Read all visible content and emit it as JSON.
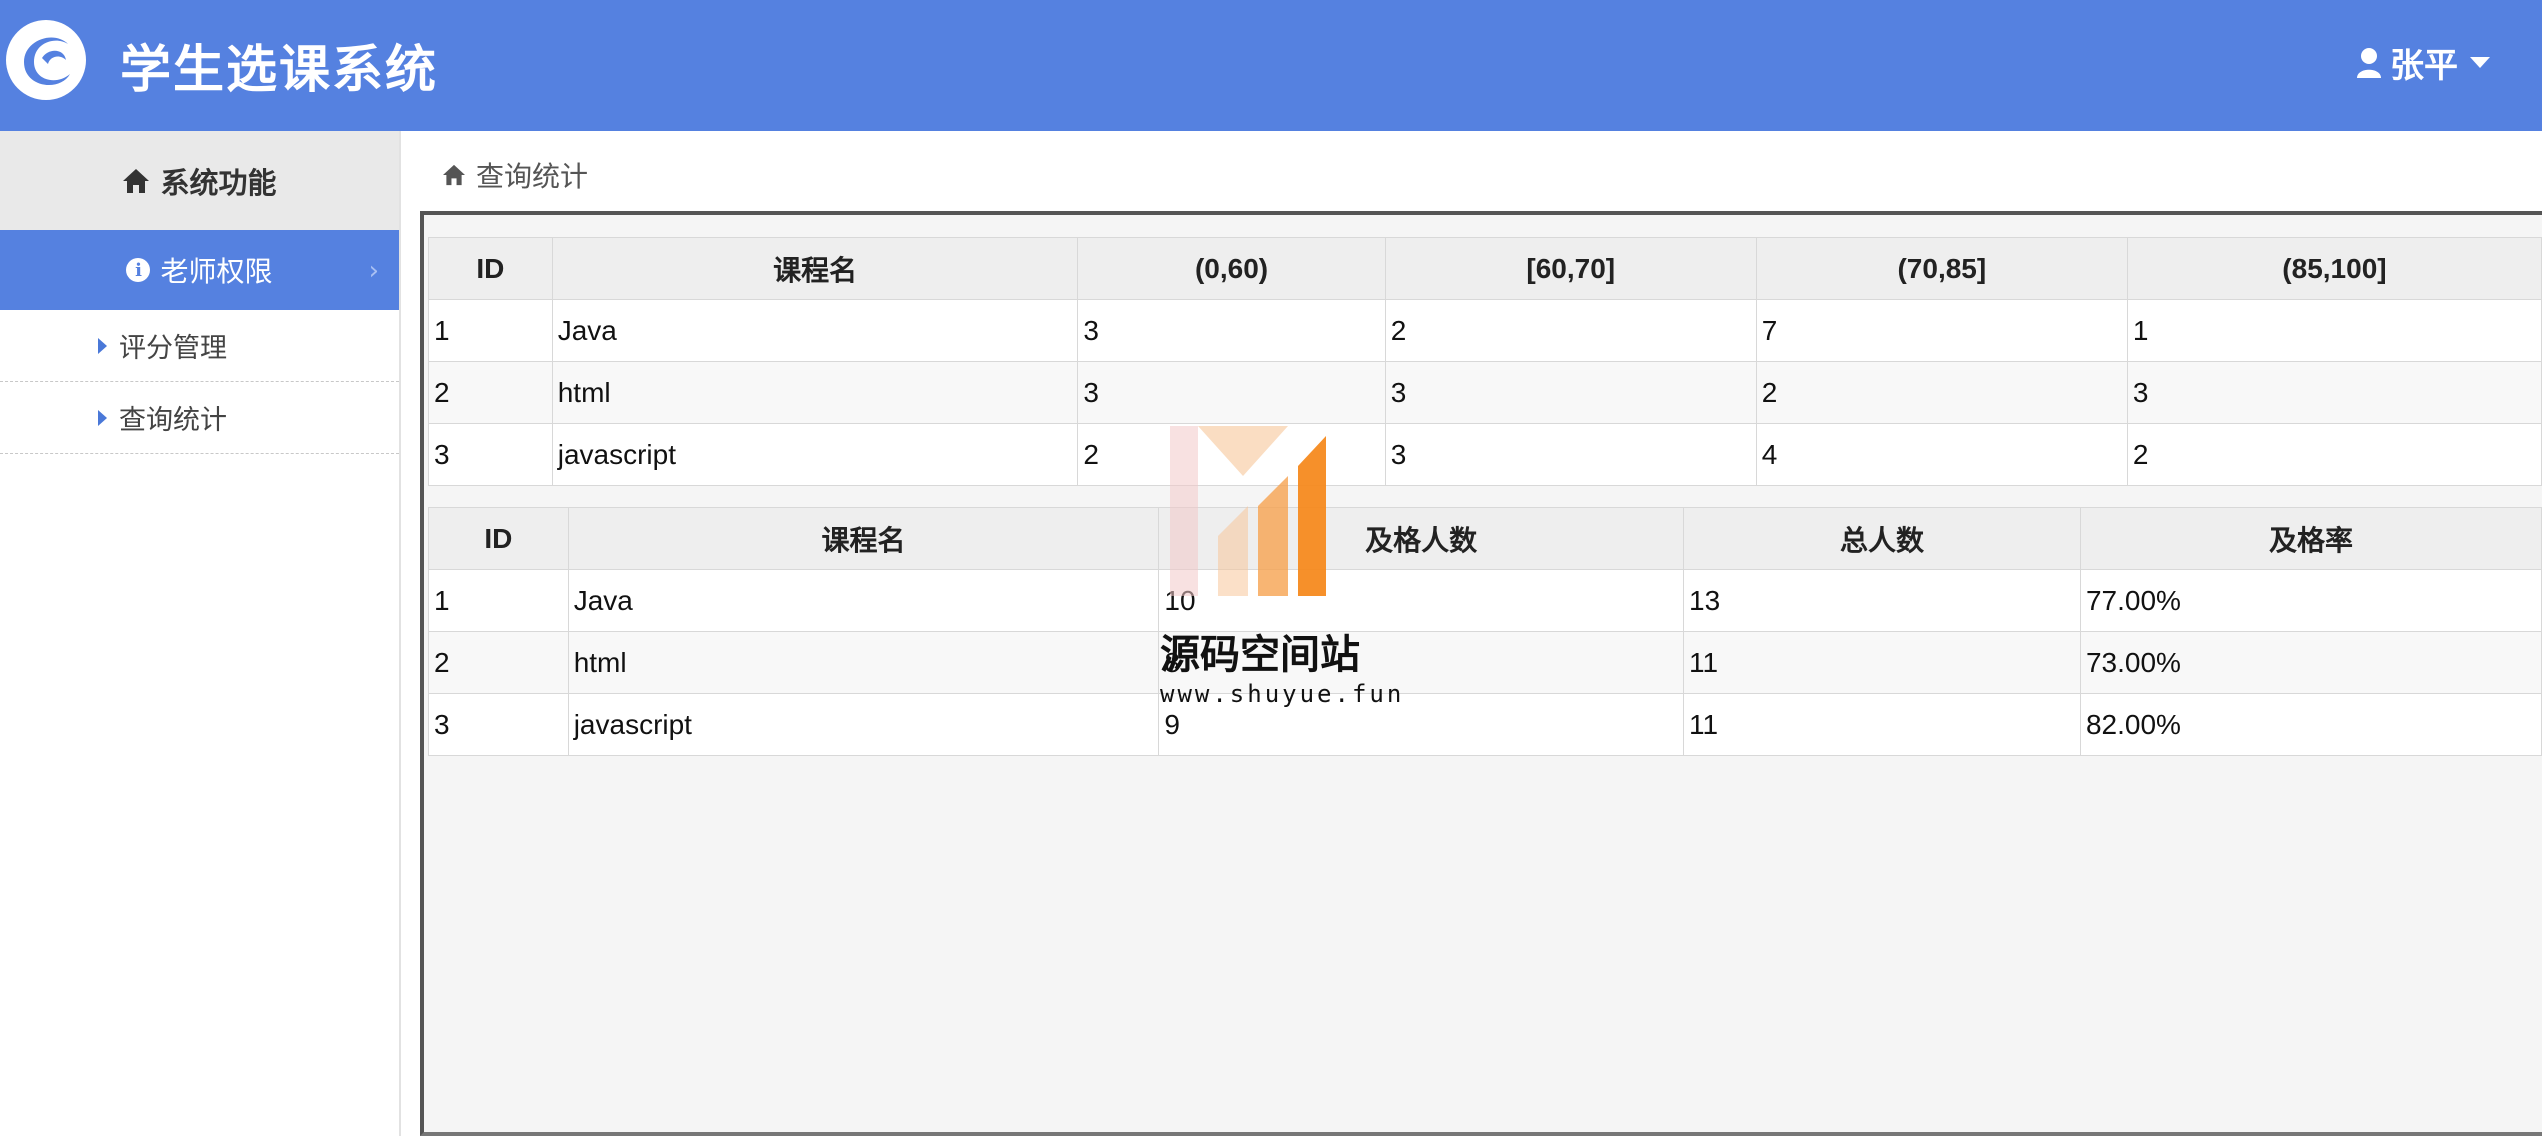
{
  "header": {
    "app_title": "学生选课系统",
    "user_name": "张平",
    "background_color": "#5581e0"
  },
  "sidebar": {
    "heading": "系统功能",
    "group_label": "老师权限",
    "items": [
      {
        "label": "评分管理"
      },
      {
        "label": "查询统计"
      }
    ]
  },
  "breadcrumb": {
    "label": "查询统计"
  },
  "score_table": {
    "headers": [
      "ID",
      "课程名",
      "(0,60)",
      "[60,70]",
      "(70,85]",
      "(85,100]"
    ],
    "rows": [
      [
        "1",
        "Java",
        "3",
        "2",
        "7",
        "1"
      ],
      [
        "2",
        "html",
        "3",
        "3",
        "2",
        "3"
      ],
      [
        "3",
        "javascript",
        "2",
        "3",
        "4",
        "2"
      ]
    ]
  },
  "pass_table": {
    "headers": [
      "ID",
      "课程名",
      "及格人数",
      "总人数",
      "及格率"
    ],
    "rows": [
      [
        "1",
        "Java",
        "10",
        "13",
        "77.00%"
      ],
      [
        "2",
        "html",
        "8",
        "11",
        "73.00%"
      ],
      [
        "3",
        "javascript",
        "9",
        "11",
        "82.00%"
      ]
    ]
  },
  "watermark": {
    "name": "源码空间站",
    "url": "www.shuyue.fun"
  }
}
